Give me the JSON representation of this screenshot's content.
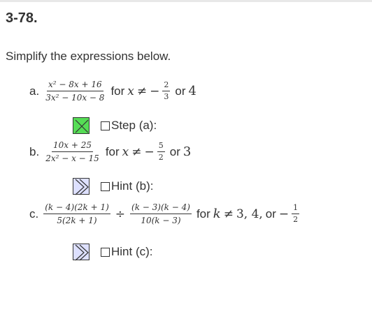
{
  "problem_number": "3-78.",
  "instructions": "Simplify the expressions below.",
  "problems": [
    {
      "label": "a.",
      "numerator": "x² − 8x + 16",
      "denominator": "3x² − 10x − 8",
      "for_text": "for",
      "variable": "x",
      "neq": "≠",
      "minus": "−",
      "excl_num": "2",
      "excl_den": "3",
      "or_text": "or",
      "excl_last": "4",
      "hint_label": "Step (a):",
      "hint_state": "done"
    },
    {
      "label": "b.",
      "numerator": "10x + 25",
      "denominator": "2x² − x − 15",
      "for_text": "for",
      "variable": "x",
      "neq": "≠",
      "minus": "−",
      "excl_num": "5",
      "excl_den": "2",
      "or_text": "or",
      "excl_last": "3",
      "hint_label": "Hint (b):",
      "hint_state": "closed"
    },
    {
      "label": "c.",
      "frac1_num": "(k − 4)(2k + 1)",
      "frac1_den": "5(2k + 1)",
      "divide": "÷",
      "frac2_num": "(k − 3)(k − 4)",
      "frac2_den": "10(k − 3)",
      "for_text": "for",
      "variable": "k",
      "neq": "≠",
      "excl_list": "3, 4,",
      "or_text": "or",
      "minus": "−",
      "excl_num": "1",
      "excl_den": "2",
      "hint_label": "Hint (c):",
      "hint_state": "closed"
    }
  ],
  "colors": {
    "hint_done": "#55dd55",
    "hint_closed": "#dde0ff",
    "text": "#333333"
  }
}
